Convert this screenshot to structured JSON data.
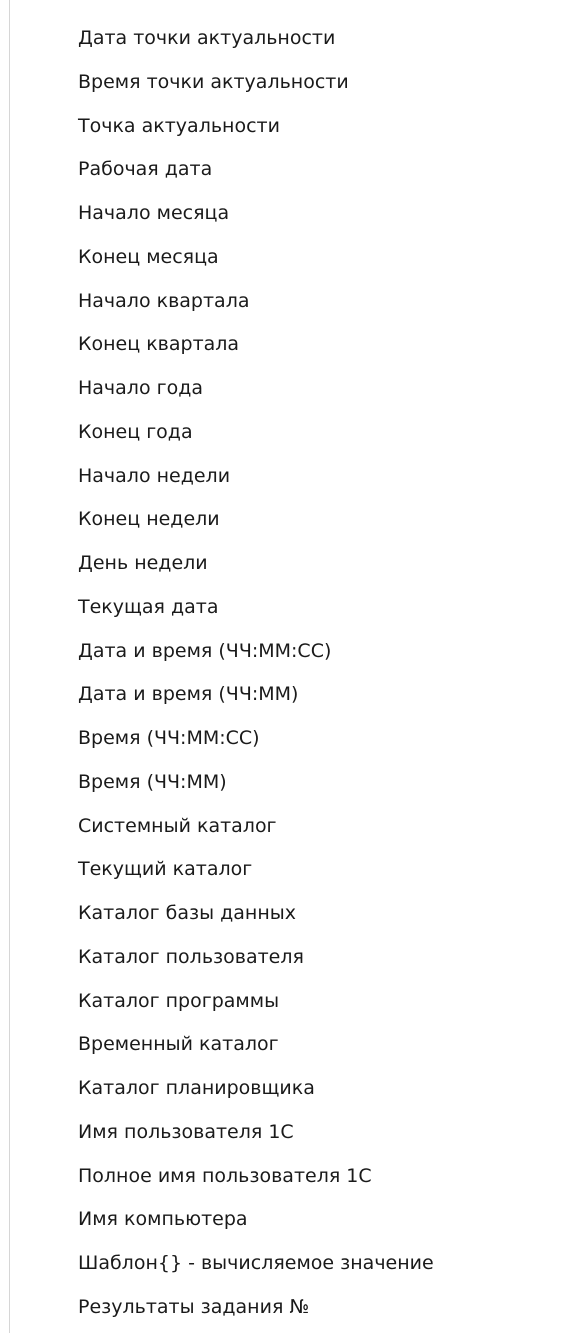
{
  "menu": {
    "items": [
      "Дата точки актуальности",
      "Время точки актуальности",
      "Точка актуальности",
      "Рабочая дата",
      "Начало месяца",
      "Конец месяца",
      "Начало квартала",
      "Конец квартала",
      "Начало года",
      "Конец года",
      "Начало недели",
      "Конец недели",
      "День недели",
      "Текущая дата",
      "Дата и время (ЧЧ:ММ:СС)",
      "Дата и время (ЧЧ:ММ)",
      "Время (ЧЧ:ММ:СС)",
      "Время (ЧЧ:ММ)",
      "Системный каталог",
      "Текущий каталог",
      "Каталог базы данных",
      "Каталог пользователя",
      "Каталог программы",
      "Временный каталог",
      "Каталог планировщика",
      "Имя пользователя 1С",
      "Полное имя пользователя 1С",
      "Имя компьютера",
      "Шаблон{} - вычисляемое значение",
      "Результаты задания №"
    ]
  }
}
